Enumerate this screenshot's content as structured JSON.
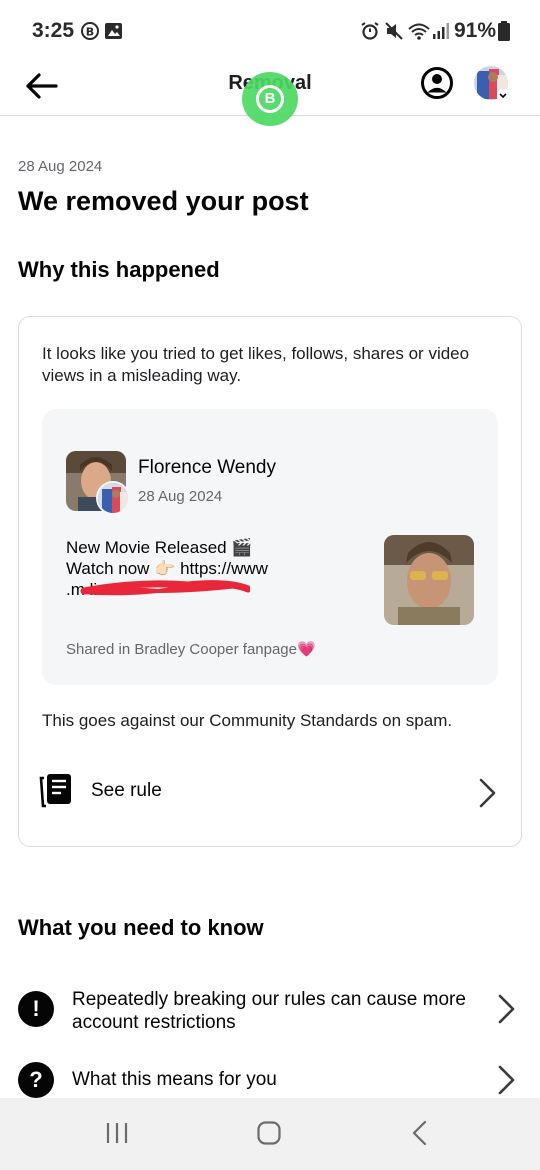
{
  "status_bar": {
    "time": "3:25",
    "battery": "91%",
    "icons": [
      "b-badge-icon",
      "gallery-icon",
      "alarm-icon",
      "mute-icon",
      "wifi-icon",
      "signal-icon",
      "battery-icon"
    ]
  },
  "header": {
    "title": "Removal",
    "back_icon": "arrow-left-icon",
    "profile_icon": "account-circle-icon",
    "floating_badge": "B"
  },
  "main": {
    "date": "28 Aug 2024",
    "title": "We removed your post",
    "why_title": "Why this happened",
    "card": {
      "intro": "It looks like you tried to get likes, follows, shares or video views in a misleading way.",
      "post": {
        "author": "Florence Wendy",
        "date": "28 Aug 2024",
        "text_line1": "New Movie Released 🎬",
        "text_line2": "Watch now 👉🏻 https://www",
        "text_line3": ".m                              line/",
        "shared_in": "Shared in Bradley Cooper fanpage💗"
      },
      "note": "This goes against our Community Standards on spam.",
      "see_rule": "See rule"
    },
    "know_title": "What you need to know",
    "info_items": [
      {
        "icon": "!",
        "text": "Repeatedly breaking our rules can cause more account restrictions"
      },
      {
        "icon": "?",
        "text": "What this means for you"
      }
    ]
  },
  "colors": {
    "text_primary": "#050505",
    "text_secondary": "#65676b",
    "card_border": "#dcdde1",
    "post_bg": "#f5f6f7",
    "redaction": "#e8283a",
    "whatsapp_green": "#4cd964"
  }
}
